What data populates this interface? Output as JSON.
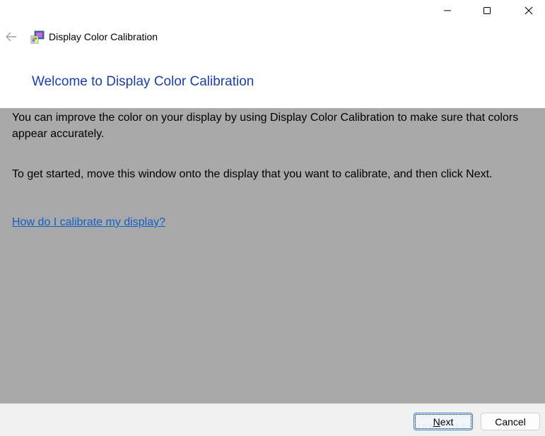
{
  "window": {
    "title": "Display Color Calibration"
  },
  "heading": "Welcome to Display Color Calibration",
  "paragraphs": [
    "You can improve the color on your display by using Display Color Calibration to make sure that colors appear accurately.",
    "To get started, move this window onto the display that you want to calibrate, and then click Next."
  ],
  "help_link": "How do I calibrate my display?",
  "buttons": {
    "next": "Next",
    "cancel": "Cancel"
  },
  "colors": {
    "heading": "#1a3fa5",
    "link": "#1060c8",
    "content_bg": "#a9a9a9"
  }
}
